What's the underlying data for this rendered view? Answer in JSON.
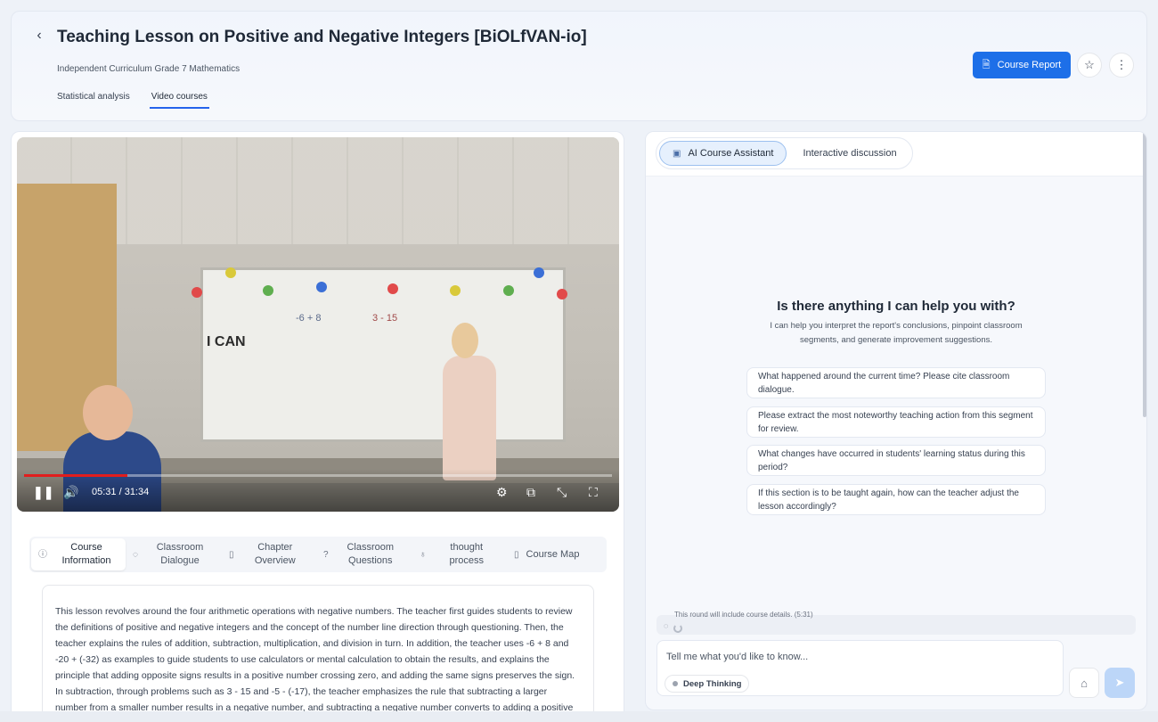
{
  "header": {
    "title": "Teaching Lesson on Positive and Negative Integers [BiOLfVAN-io]",
    "subtitle": "Independent Curriculum Grade 7 Mathematics",
    "tabs": [
      {
        "label": "Statistical analysis",
        "active": false
      },
      {
        "label": "Video courses",
        "active": true
      }
    ],
    "report_button": "Course Report",
    "accent_color": "#1d6fe8"
  },
  "video": {
    "time_readout": "05:31 / 31:34",
    "progress_fraction": 0.175,
    "board_texts": [
      "I CAN",
      "-6 + 8",
      "3 - 15"
    ]
  },
  "info_tabs": [
    {
      "icon": "info-icon",
      "label": "Course Information",
      "active": true
    },
    {
      "icon": "chat-bubble-icon",
      "label": "Classroom Dialogue",
      "active": false
    },
    {
      "icon": "document-icon",
      "label": "Chapter Overview",
      "active": false
    },
    {
      "icon": "question-icon",
      "label": "Classroom Questions",
      "active": false
    },
    {
      "icon": "lightbulb-icon",
      "label": "thought process",
      "active": false
    },
    {
      "icon": "map-icon",
      "label": "Course Map",
      "active": false
    }
  ],
  "description": "This lesson revolves around the four arithmetic operations with negative numbers. The teacher first guides students to review the definitions of positive and negative integers and the concept of the number line direction through questioning. Then, the teacher explains the rules of addition, subtraction, multiplication, and division in turn. In addition, the teacher uses -6 + 8 and -20 + (-32) as examples to guide students to use calculators or mental calculation to obtain the results, and explains the principle that adding opposite signs results in a positive number crossing zero, and adding the same signs preserves the sign. In subtraction, through problems such as 3 - 15 and -5 - (-17), the teacher emphasizes the rule that subtracting a larger number from a smaller number results in a negative number, and subtracting a negative number converts to adding a positive number.",
  "assistant": {
    "tabs": [
      {
        "label": "AI Course Assistant",
        "active": true
      },
      {
        "label": "Interactive discussion",
        "active": false
      }
    ],
    "help_title": "Is there anything I can help you with?",
    "help_sub": "I can help you interpret the report's conclusions, pinpoint classroom segments, and generate improvement suggestions.",
    "suggestions": [
      " What happened around the current time? Please cite classroom dialogue.",
      " Please extract the most noteworthy teaching action from this segment for review.",
      " What changes have occurred in students' learning status during this period?",
      " If this section is to be taught again, how can the teacher adjust the lesson accordingly?"
    ],
    "context_note": "This round will include course details. (5:31)",
    "input_placeholder": "Tell me what you'd like to know...",
    "deep_thinking_label": "Deep Thinking"
  }
}
